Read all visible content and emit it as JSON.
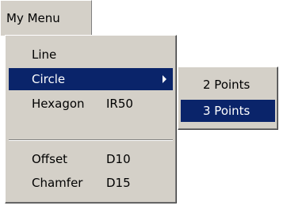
{
  "menubar": {
    "title": "My Menu"
  },
  "menu": {
    "items": [
      {
        "label": "Line",
        "accel": ""
      },
      {
        "label": "Circle",
        "accel": "",
        "has_submenu": true,
        "highlighted": true
      },
      {
        "label": "Hexagon",
        "accel": "IR50"
      },
      {
        "label": "Offset",
        "accel": "D10"
      },
      {
        "label": "Chamfer",
        "accel": "D15"
      }
    ]
  },
  "submenu": {
    "items": [
      {
        "label": "2 Points"
      },
      {
        "label": "3 Points",
        "highlighted": true
      }
    ]
  },
  "colors": {
    "menu_bg": "#d4d0c8",
    "highlight_bg": "#0a246a",
    "highlight_text": "#ffffff"
  }
}
